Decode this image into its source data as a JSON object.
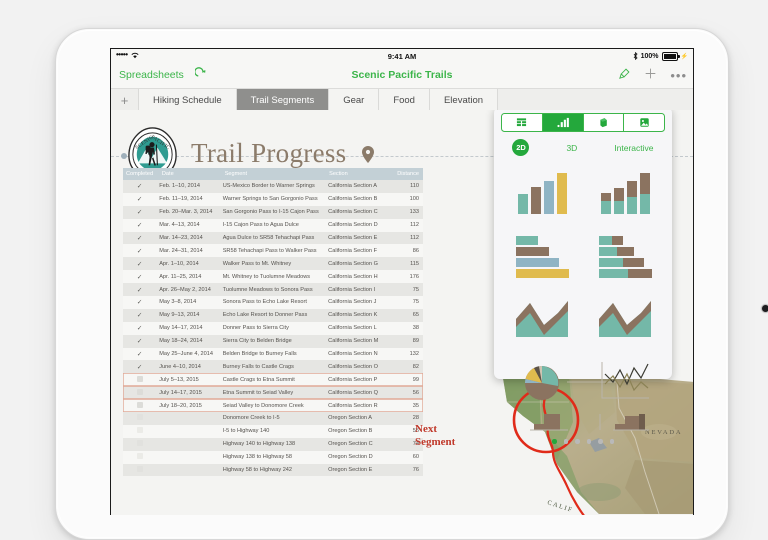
{
  "device": {
    "type": "tablet-white"
  },
  "status_bar": {
    "signal_dots": "•••••",
    "wifi_icon": "wifi-icon",
    "time": "9:41 AM",
    "bluetooth_icon": "bluetooth-icon",
    "battery_percent": "100%"
  },
  "nav_bar": {
    "back_label": "Spreadsheets",
    "undo_icon": "undo-icon",
    "title": "Scenic Pacific Trails",
    "right_icons": [
      "brush-icon",
      "plus-icon",
      "more-icon"
    ],
    "accent_color": "#3cb54a"
  },
  "tabs": {
    "add_label": "+",
    "items": [
      {
        "label": "Hiking Schedule",
        "active": false
      },
      {
        "label": "Trail Segments",
        "active": true
      },
      {
        "label": "Gear",
        "active": false
      },
      {
        "label": "Food",
        "active": false
      },
      {
        "label": "Elevation",
        "active": false
      }
    ]
  },
  "sheet": {
    "logo_text_top": "SCENIC",
    "logo_text_right": "PACIFIC",
    "logo_text_bottom": "TRAILS",
    "title": "Trail Progress",
    "pin_icon": "location-pin-icon",
    "title_color": "#8b7b6a"
  },
  "table": {
    "headers": [
      "Completed",
      "Date",
      "Segment",
      "Section",
      "Distance"
    ],
    "header_bg": "#c3d0d6",
    "rows": [
      {
        "completed": true,
        "date": "Feb. 1–10, 2014",
        "segment": "US-Mexico Border to Warner Springs",
        "section": "California Section A",
        "distance": "110",
        "selected": false
      },
      {
        "completed": true,
        "date": "Feb. 11–19, 2014",
        "segment": "Warner Springs to San Gorgonio Pass",
        "section": "California Section B",
        "distance": "100",
        "selected": false
      },
      {
        "completed": true,
        "date": "Feb. 20–Mar. 3, 2014",
        "segment": "San Gorgonio Pass to I-15 Cajon Pass",
        "section": "California Section C",
        "distance": "133",
        "selected": false
      },
      {
        "completed": true,
        "date": "Mar. 4–13, 2014",
        "segment": "I-15 Cajon Pass to Agua Dulce",
        "section": "California Section D",
        "distance": "112",
        "selected": false
      },
      {
        "completed": true,
        "date": "Mar. 14–23, 2014",
        "segment": "Agua Dulce to SR58 Tehachapi Pass",
        "section": "California Section E",
        "distance": "112",
        "selected": false
      },
      {
        "completed": true,
        "date": "Mar. 24–31, 2014",
        "segment": "SR58 Tehachapi Pass to Walker Pass",
        "section": "California Section F",
        "distance": "86",
        "selected": false
      },
      {
        "completed": true,
        "date": "Apr. 1–10, 2014",
        "segment": "Walker Pass to Mt. Whitney",
        "section": "California Section G",
        "distance": "115",
        "selected": false
      },
      {
        "completed": true,
        "date": "Apr. 11–25, 2014",
        "segment": "Mt. Whitney to Tuolumne Meadows",
        "section": "California Section H",
        "distance": "176",
        "selected": false
      },
      {
        "completed": true,
        "date": "Apr. 26–May 2, 2014",
        "segment": "Tuolumne Meadows to Sonora Pass",
        "section": "California Section I",
        "distance": "75",
        "selected": false
      },
      {
        "completed": true,
        "date": "May 3–8, 2014",
        "segment": "Sonora Pass to Echo Lake Resort",
        "section": "California Section J",
        "distance": "75",
        "selected": false
      },
      {
        "completed": true,
        "date": "May 9–13, 2014",
        "segment": "Echo Lake Resort to Donner Pass",
        "section": "California Section K",
        "distance": "65",
        "selected": false
      },
      {
        "completed": true,
        "date": "May 14–17, 2014",
        "segment": "Donner Pass to Sierra City",
        "section": "California Section L",
        "distance": "38",
        "selected": false
      },
      {
        "completed": true,
        "date": "May 18–24, 2014",
        "segment": "Sierra City to Belden Bridge",
        "section": "California Section M",
        "distance": "89",
        "selected": false
      },
      {
        "completed": true,
        "date": "May 25–June 4, 2014",
        "segment": "Belden Bridge to Burney Falls",
        "section": "California Section N",
        "distance": "132",
        "selected": false
      },
      {
        "completed": true,
        "date": "June 4–10, 2014",
        "segment": "Burney Falls to Castle Crags",
        "section": "California Section O",
        "distance": "82",
        "selected": false
      },
      {
        "completed": false,
        "date": "July 5–13, 2015",
        "segment": "Castle Crags to Etna Summit",
        "section": "California Section P",
        "distance": "99",
        "selected": true
      },
      {
        "completed": false,
        "date": "July 14–17, 2015",
        "segment": "Etna Summit to Seiad Valley",
        "section": "California Section Q",
        "distance": "56",
        "selected": true
      },
      {
        "completed": false,
        "date": "July 18–20, 2015",
        "segment": "Seiad Valley to Donomore Creek",
        "section": "California Section R",
        "distance": "35",
        "selected": true
      },
      {
        "completed": false,
        "date": "",
        "segment": "Donomore Creek to I-5",
        "section": "Oregon Section A",
        "distance": "28",
        "selected": false
      },
      {
        "completed": false,
        "date": "",
        "segment": "I-5 to Highway 140",
        "section": "Oregon Section B",
        "distance": "55",
        "selected": false
      },
      {
        "completed": false,
        "date": "",
        "segment": "Highway 140 to Highway 138",
        "section": "Oregon Section C",
        "distance": "74",
        "selected": false
      },
      {
        "completed": false,
        "date": "",
        "segment": "Highway 138 to Highway 58",
        "section": "Oregon Section D",
        "distance": "60",
        "selected": false
      },
      {
        "completed": false,
        "date": "",
        "segment": "Highway 58 to Highway 242",
        "section": "Oregon Section E",
        "distance": "76",
        "selected": false
      }
    ]
  },
  "map": {
    "label_nevada": "NEVADA",
    "label_california": "CALIF",
    "annotation": "Next\nSegment",
    "annotation_line1": "Next",
    "annotation_line2": "Segment",
    "annotation_color": "#c0392b",
    "route_color": "#e02b1a"
  },
  "popover": {
    "segmented": [
      {
        "icon": "table-icon",
        "active": false
      },
      {
        "icon": "chart-icon",
        "active": true
      },
      {
        "icon": "shape-icon",
        "active": false
      },
      {
        "icon": "media-icon",
        "active": false
      }
    ],
    "modes": [
      {
        "label": "2D",
        "active": true
      },
      {
        "label": "3D",
        "active": false
      },
      {
        "label": "Interactive",
        "active": false
      }
    ],
    "chart_types": [
      "column-chart",
      "stacked-column-chart",
      "bar-chart",
      "stacked-bar-chart",
      "area-chart",
      "stacked-area-chart",
      "pie-chart",
      "line-chart",
      "scatter-chart-partial-left",
      "scatter-chart-partial-right"
    ],
    "page_dots": 6,
    "active_page": 0,
    "accent_color": "#24a83c",
    "palette": {
      "teal": "#74b8a8",
      "brown": "#8b7360",
      "blue": "#8fb4c4",
      "gold": "#e0bb4e"
    }
  },
  "chart_data": {
    "type": "table",
    "title": "Trail Progress",
    "columns": [
      "Completed",
      "Date",
      "Segment",
      "Section",
      "Distance"
    ],
    "categories": [
      "California Section A",
      "California Section B",
      "California Section C",
      "California Section D",
      "California Section E",
      "California Section F",
      "California Section G",
      "California Section H",
      "California Section I",
      "California Section J",
      "California Section K",
      "California Section L",
      "California Section M",
      "California Section N",
      "California Section O",
      "California Section P",
      "California Section Q",
      "California Section R",
      "Oregon Section A",
      "Oregon Section B",
      "Oregon Section C",
      "Oregon Section D",
      "Oregon Section E"
    ],
    "series": [
      {
        "name": "Distance",
        "values": [
          110,
          100,
          133,
          112,
          112,
          86,
          115,
          176,
          75,
          75,
          65,
          38,
          89,
          132,
          82,
          99,
          56,
          35,
          28,
          55,
          74,
          60,
          76
        ]
      }
    ],
    "xlabel": "Section",
    "ylabel": "Distance"
  }
}
